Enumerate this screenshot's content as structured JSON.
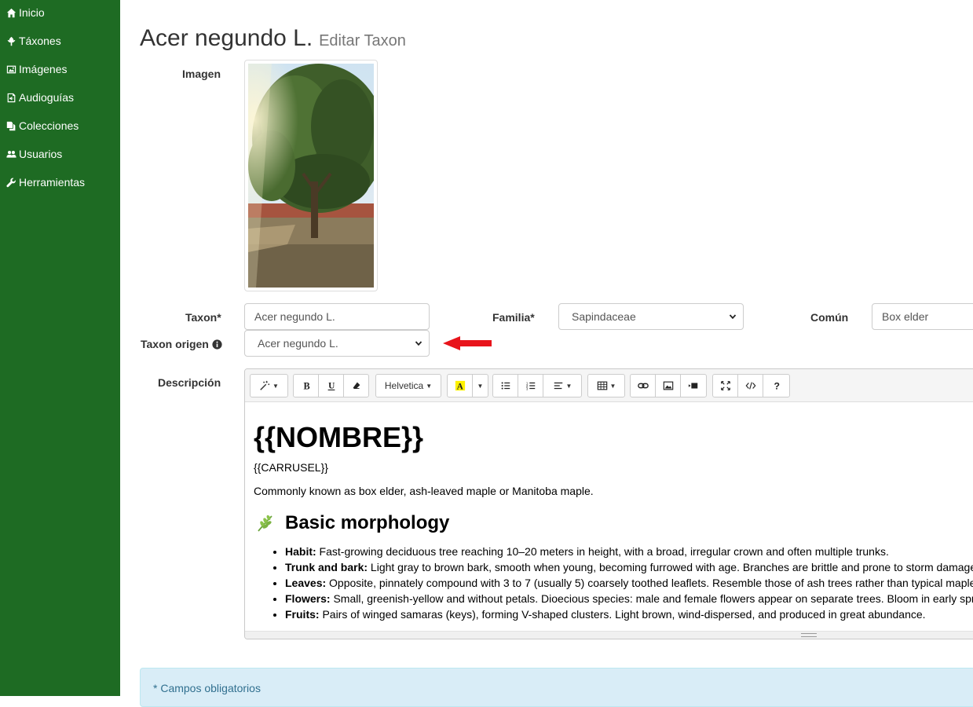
{
  "sidebar": {
    "items": [
      {
        "label": "Inicio",
        "icon": "home-icon"
      },
      {
        "label": "Táxones",
        "icon": "leaf-icon"
      },
      {
        "label": "Imágenes",
        "icon": "image-icon"
      },
      {
        "label": "Audioguías",
        "icon": "audio-icon"
      },
      {
        "label": "Colecciones",
        "icon": "files-icon"
      },
      {
        "label": "Usuarios",
        "icon": "users-icon"
      },
      {
        "label": "Herramientas",
        "icon": "wrench-icon"
      }
    ]
  },
  "header": {
    "title": "Acer negundo L.",
    "subtitle": "Editar Taxon"
  },
  "form": {
    "image_label": "Imagen",
    "taxon_label": "Taxon*",
    "taxon_value": "Acer negundo L.",
    "familia_label": "Familia*",
    "familia_value": "Sapindaceae",
    "comun_label": "Común",
    "comun_value": "Box elder",
    "origen_label": "Taxon origen",
    "origen_value": "Acer negundo L.",
    "descripcion_label": "Descripción"
  },
  "editor": {
    "toolbar": {
      "font_name": "Helvetica"
    },
    "content": {
      "heading": "{{NOMBRE}}",
      "carrusel": "{{CARRUSEL}}",
      "common_names": "Commonly known as box elder, ash-leaved maple or Manitoba maple.",
      "section_title": "Basic morphology",
      "items": [
        {
          "term": "Habit:",
          "text": " Fast-growing deciduous tree reaching 10–20 meters in height, with a broad, irregular crown and often multiple trunks."
        },
        {
          "term": "Trunk and bark:",
          "text": " Light gray to brown bark, smooth when young, becoming furrowed with age. Branches are brittle and prone to storm damage."
        },
        {
          "term": "Leaves:",
          "text": " Opposite, pinnately compound with 3 to 7 (usually 5) coarsely toothed leaflets. Resemble those of ash trees rather than typical maples."
        },
        {
          "term": "Flowers:",
          "text": " Small, greenish-yellow and without petals. Dioecious species: male and female flowers appear on separate trees. Bloom in early spring."
        },
        {
          "term": "Fruits:",
          "text": " Pairs of winged samaras (keys), forming V-shaped clusters. Light brown, wind-dispersed, and produced in great abundance."
        }
      ]
    }
  },
  "footer": {
    "required_note": "* Campos obligatorios"
  },
  "colors": {
    "sidebar_bg": "#1e6b23",
    "alert_bg": "#d9edf7",
    "alert_text": "#31708f",
    "arrow": "#e8141b"
  }
}
